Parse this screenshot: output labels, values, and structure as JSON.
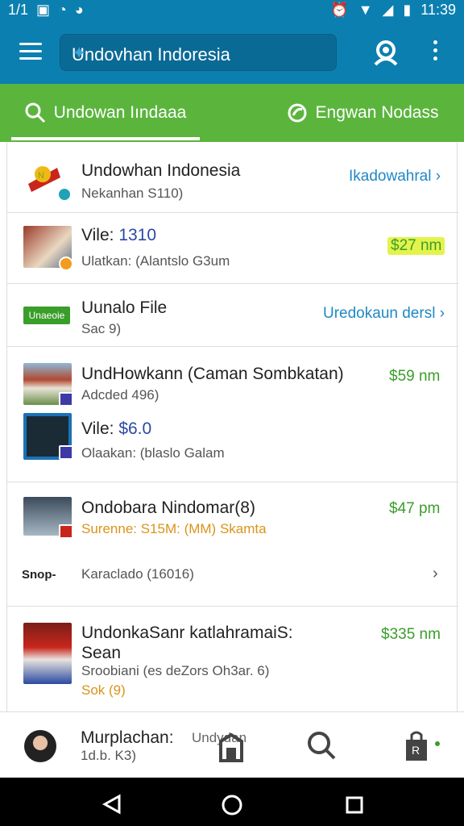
{
  "status": {
    "left_text": "1/1",
    "time": "11:39"
  },
  "appbar": {
    "search_value": "Undovhan Indoresia"
  },
  "tabs": [
    {
      "label": "Undowan Iındaaa"
    },
    {
      "label": "Engwan Nodass"
    }
  ],
  "rows": [
    {
      "title": "Undowhan Indonesia",
      "sub": "Nekanhan S110)",
      "action": "Ikadowahral"
    },
    {
      "title_prefix": "Vile:",
      "title_value": "1310",
      "sub": "Ulatkan: (Alantslo G3um",
      "price": "$27 nm"
    },
    {
      "badge": "Unaeoie",
      "title": "Uunalo File",
      "sub": "Sac 9)",
      "action": "Uredokaun dersl"
    },
    {
      "title": "UndHowkann (Caman Sombkatan)",
      "sub": "Adcded 496)",
      "price": "$59 nm"
    },
    {
      "title_prefix": "Vile:",
      "title_value": "$6.0",
      "sub": "Olaakan: (blaslo Galam"
    },
    {
      "title": "Ondobara Nindomar(8)",
      "sub": "Surenne: S15M: (MM) Skamta",
      "price": "$47 pm"
    },
    {
      "logo": "Snop-",
      "title": "Karaclado (16016)"
    },
    {
      "title": "UndonkaSanr katlahramaiS: Sean",
      "sub": "Sroobiani (es deZors Oh3ar. 6)",
      "sub2": "Sok (9)",
      "price": "$335 nm"
    }
  ],
  "bottombar": {
    "title": "Murplachan:",
    "label": "Undydan",
    "sub": "1d.b. K3)"
  },
  "colors": {
    "primary": "#0b7fb0",
    "tab": "#5bb53d",
    "price": "#3a9e2a",
    "link": "#1f88c7"
  }
}
